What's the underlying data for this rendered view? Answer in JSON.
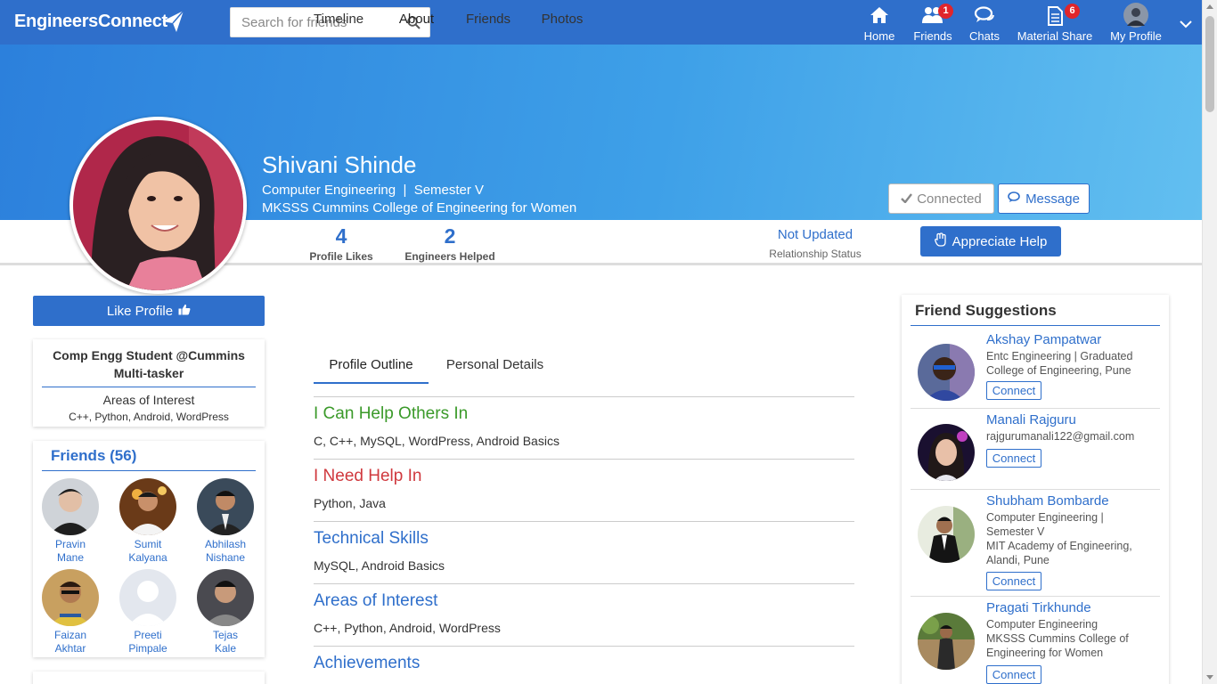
{
  "navbar": {
    "logo": "EngineersConnect",
    "search_placeholder": "Search for friends",
    "items": [
      {
        "label": "Home",
        "icon": "home-icon"
      },
      {
        "label": "Friends",
        "icon": "friends-icon",
        "badge": "1"
      },
      {
        "label": "Chats",
        "icon": "chats-icon"
      },
      {
        "label": "Material Share",
        "icon": "document-icon",
        "badge": "6"
      },
      {
        "label": "My Profile",
        "icon": "avatar"
      }
    ]
  },
  "profile": {
    "name": "Shivani Shinde",
    "branch": "Computer Engineering",
    "separator": "|",
    "semester": "Semester V",
    "college": "MKSSS Cummins College of Engineering for Women",
    "connected_label": "Connected",
    "message_label": "Message",
    "likes": "4",
    "likes_caption": "Profile Likes",
    "helped": "2",
    "helped_caption": "Engineers Helped",
    "relationship": "Not Updated",
    "relationship_caption": "Relationship Status",
    "appreciate_label": "Appreciate Help",
    "like_label": "Like Profile"
  },
  "bio": {
    "line1": "Comp Engg Student @Cummins",
    "line2": "Multi-tasker",
    "interest_title": "Areas of Interest",
    "interest_value": "C++, Python, Android, WordPress"
  },
  "friends": {
    "title": "Friends (56)",
    "list": [
      {
        "first": "Pravin",
        "last": "Mane"
      },
      {
        "first": "Sumit",
        "last": "Kalyana"
      },
      {
        "first": "Abhilash",
        "last": "Nishane"
      },
      {
        "first": "Faizan",
        "last": "Akhtar"
      },
      {
        "first": "Preeti",
        "last": "Pimpale"
      },
      {
        "first": "Tejas",
        "last": "Kale"
      }
    ]
  },
  "tabs": [
    "Timeline",
    "About",
    "Friends",
    "Photos"
  ],
  "subtabs": [
    "Profile Outline",
    "Personal Details"
  ],
  "sections": [
    {
      "title": "I Can Help Others In",
      "body": "C, C++, MySQL, WordPress, Android Basics",
      "color": "#3b9a2a"
    },
    {
      "title": "I Need Help In",
      "body": "Python, Java",
      "color": "#d0393e"
    },
    {
      "title": "Technical Skills",
      "body": "MySQL, Android Basics",
      "color": "#2f6fcb"
    },
    {
      "title": "Areas of Interest",
      "body": "C++, Python, Android, WordPress",
      "color": "#2f6fcb"
    },
    {
      "title": "Achievements",
      "body": "",
      "color": "#2f6fcb"
    }
  ],
  "suggestions": {
    "title": "Friend Suggestions",
    "connect_label": "Connect",
    "list": [
      {
        "name": "Akshay Pampatwar",
        "line1": "Entc Engineering | Graduated",
        "line2": "College of Engineering, Pune"
      },
      {
        "name": "Manali Rajguru",
        "line1": "rajgurumanali122@gmail.com"
      },
      {
        "name": "Shubham Bombarde",
        "line1": "Computer Engineering |",
        "line2": "Semester V",
        "line3": "MIT Academy of Engineering,",
        "line4": "Alandi, Pune"
      },
      {
        "name": "Pragati Tirkhunde",
        "line1": "Computer Engineering",
        "line2": "MKSSS Cummins College of",
        "line3": "Engineering for Women"
      }
    ]
  },
  "colors": {
    "brand": "#2f6fcb",
    "badge": "#e0252b",
    "green": "#3b9a2a",
    "red": "#d0393e"
  }
}
